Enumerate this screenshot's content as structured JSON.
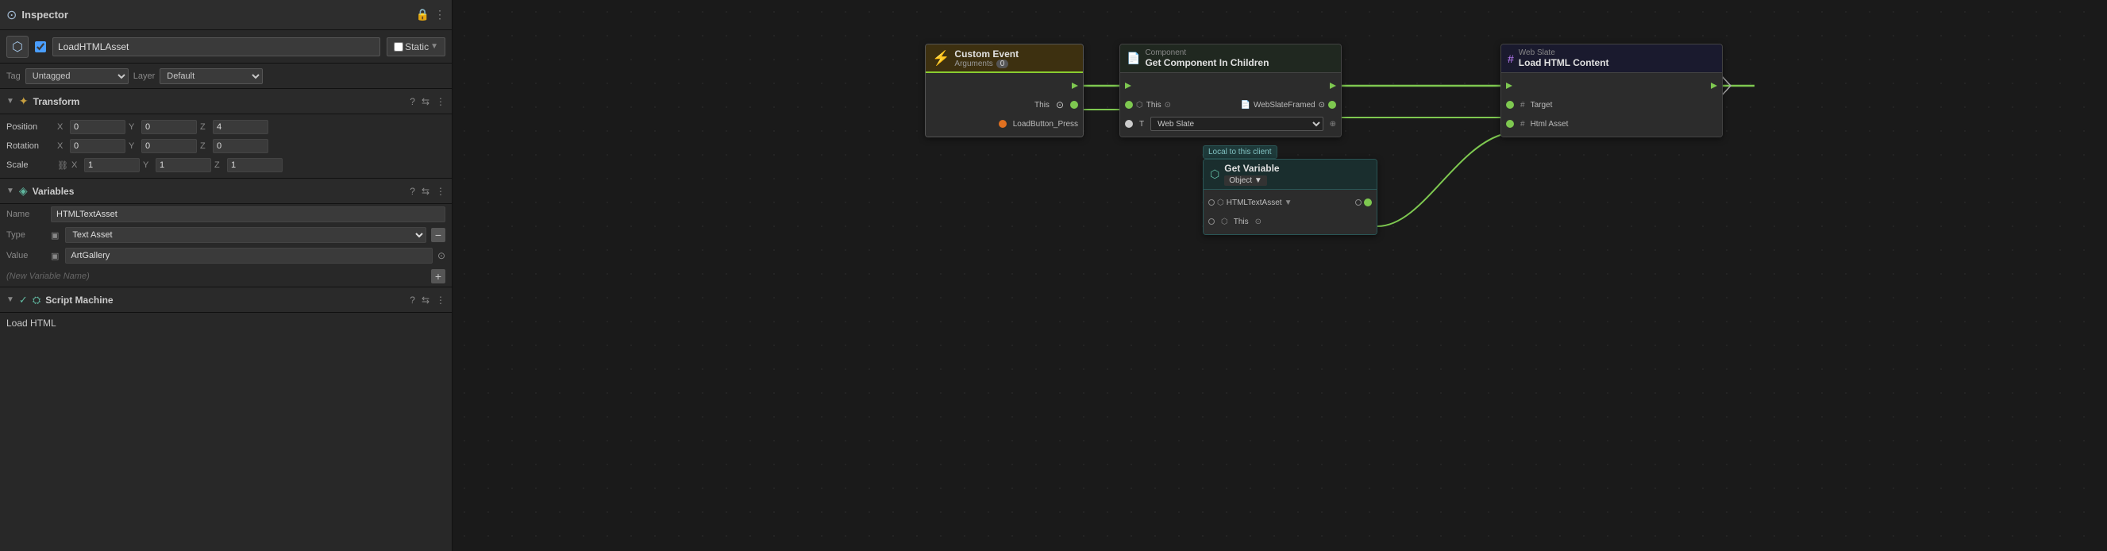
{
  "inspector": {
    "title": "Inspector",
    "lock_icon": "🔒",
    "menu_icon": "⋮",
    "game_object": {
      "name": "LoadHTMLAsset",
      "static_label": "Static",
      "tag_label": "Tag",
      "tag_value": "Untagged",
      "layer_label": "Layer",
      "layer_value": "Default"
    },
    "transform": {
      "title": "Transform",
      "position_label": "Position",
      "rotation_label": "Rotation",
      "scale_label": "Scale",
      "position": {
        "x": "0",
        "y": "0",
        "z": "4"
      },
      "rotation": {
        "x": "0",
        "y": "0",
        "z": "0"
      },
      "scale": {
        "x": "1",
        "y": "1",
        "z": "1"
      }
    },
    "variables": {
      "title": "Variables",
      "name_label": "Name",
      "name_value": "HTMLTextAsset",
      "type_label": "Type",
      "type_value": "Text Asset",
      "value_label": "Value",
      "value_value": "ArtGallery",
      "new_var_placeholder": "(New Variable Name)",
      "plus_label": "+"
    },
    "script_machine": {
      "title": "Script Machine",
      "body_label": "Load HTML"
    }
  },
  "graph": {
    "nodes": {
      "custom_event": {
        "header_label": "Custom Event",
        "sub_label": "Arguments",
        "arg_count": "0",
        "pin1_label": "This",
        "pin2_label": "LoadButton_Press"
      },
      "get_component": {
        "header_label1": "Component",
        "header_label2": "Get Component In Children",
        "pin_this_label": "This",
        "pin_webslate_label": "WebSlateFramed",
        "pin_t_label": "T",
        "pin_webslate_type": "Web Slate",
        "target_icon": "⊙"
      },
      "web_slate": {
        "header_label1": "Web Slate",
        "header_label2": "Load HTML Content",
        "pin_target_label": "Target",
        "pin_htmlasset_label": "Html Asset"
      },
      "get_variable": {
        "local_badge": "Local to this client",
        "header_label": "Get Variable",
        "object_label": "Object ▼",
        "pin_htmltextasset_label": "HTMLTextAsset",
        "pin_this_label": "This",
        "target_icon": "⊙"
      }
    }
  }
}
